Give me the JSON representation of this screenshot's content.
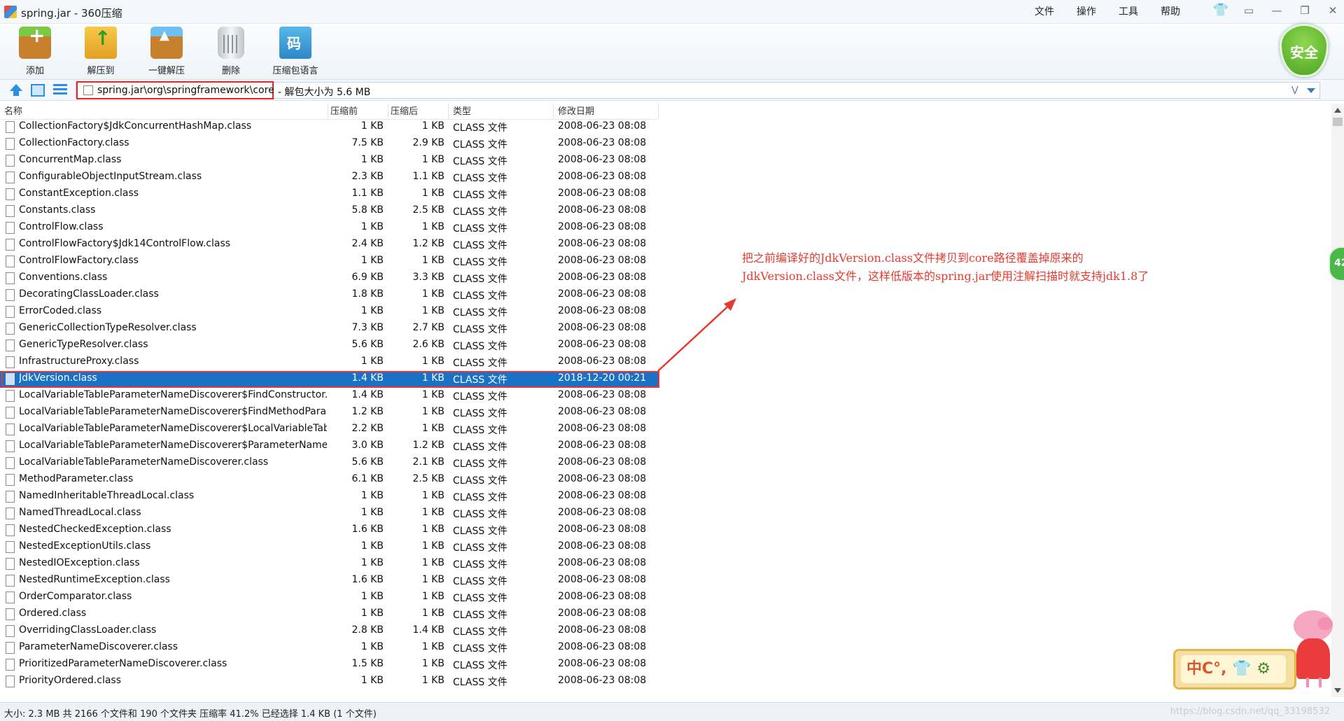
{
  "window": {
    "title": "spring.jar - 360压缩",
    "menu": [
      "文件",
      "操作",
      "工具",
      "帮助"
    ]
  },
  "toolbar": {
    "add_label": "添加",
    "extract_label": "解压到",
    "onekey_label": "一键解压",
    "delete_label": "删除",
    "lang_label": "压缩包语言",
    "security_label": "安全"
  },
  "address": {
    "path": "spring.jar\\org\\springframework\\core",
    "info": " - 解包大小为 5.6 MB",
    "v_icon": "V"
  },
  "columns": {
    "name": "名称",
    "size": "压缩前",
    "packed": "压缩后",
    "type": "类型",
    "date": "修改日期"
  },
  "files": [
    {
      "name": "CollectionFactory$JdkConcurrentHashMap.class",
      "size": "1 KB",
      "packed": "1 KB",
      "type": "CLASS 文件",
      "date": "2008-06-23 08:08"
    },
    {
      "name": "CollectionFactory.class",
      "size": "7.5 KB",
      "packed": "2.9 KB",
      "type": "CLASS 文件",
      "date": "2008-06-23 08:08"
    },
    {
      "name": "ConcurrentMap.class",
      "size": "1 KB",
      "packed": "1 KB",
      "type": "CLASS 文件",
      "date": "2008-06-23 08:08"
    },
    {
      "name": "ConfigurableObjectInputStream.class",
      "size": "2.3 KB",
      "packed": "1.1 KB",
      "type": "CLASS 文件",
      "date": "2008-06-23 08:08"
    },
    {
      "name": "ConstantException.class",
      "size": "1.1 KB",
      "packed": "1 KB",
      "type": "CLASS 文件",
      "date": "2008-06-23 08:08"
    },
    {
      "name": "Constants.class",
      "size": "5.8 KB",
      "packed": "2.5 KB",
      "type": "CLASS 文件",
      "date": "2008-06-23 08:08"
    },
    {
      "name": "ControlFlow.class",
      "size": "1 KB",
      "packed": "1 KB",
      "type": "CLASS 文件",
      "date": "2008-06-23 08:08"
    },
    {
      "name": "ControlFlowFactory$Jdk14ControlFlow.class",
      "size": "2.4 KB",
      "packed": "1.2 KB",
      "type": "CLASS 文件",
      "date": "2008-06-23 08:08"
    },
    {
      "name": "ControlFlowFactory.class",
      "size": "1 KB",
      "packed": "1 KB",
      "type": "CLASS 文件",
      "date": "2008-06-23 08:08"
    },
    {
      "name": "Conventions.class",
      "size": "6.9 KB",
      "packed": "3.3 KB",
      "type": "CLASS 文件",
      "date": "2008-06-23 08:08"
    },
    {
      "name": "DecoratingClassLoader.class",
      "size": "1.8 KB",
      "packed": "1 KB",
      "type": "CLASS 文件",
      "date": "2008-06-23 08:08"
    },
    {
      "name": "ErrorCoded.class",
      "size": "1 KB",
      "packed": "1 KB",
      "type": "CLASS 文件",
      "date": "2008-06-23 08:08"
    },
    {
      "name": "GenericCollectionTypeResolver.class",
      "size": "7.3 KB",
      "packed": "2.7 KB",
      "type": "CLASS 文件",
      "date": "2008-06-23 08:08"
    },
    {
      "name": "GenericTypeResolver.class",
      "size": "5.6 KB",
      "packed": "2.6 KB",
      "type": "CLASS 文件",
      "date": "2008-06-23 08:08"
    },
    {
      "name": "InfrastructureProxy.class",
      "size": "1 KB",
      "packed": "1 KB",
      "type": "CLASS 文件",
      "date": "2008-06-23 08:08"
    },
    {
      "name": "JdkVersion.class",
      "size": "1.4 KB",
      "packed": "1 KB",
      "type": "CLASS 文件",
      "date": "2018-12-20 00:21",
      "selected": true
    },
    {
      "name": "LocalVariableTableParameterNameDiscoverer$FindConstructor...",
      "size": "1.4 KB",
      "packed": "1 KB",
      "type": "CLASS 文件",
      "date": "2008-06-23 08:08"
    },
    {
      "name": "LocalVariableTableParameterNameDiscoverer$FindMethodPara...",
      "size": "1.2 KB",
      "packed": "1 KB",
      "type": "CLASS 文件",
      "date": "2008-06-23 08:08"
    },
    {
      "name": "LocalVariableTableParameterNameDiscoverer$LocalVariableTab...",
      "size": "2.2 KB",
      "packed": "1 KB",
      "type": "CLASS 文件",
      "date": "2008-06-23 08:08"
    },
    {
      "name": "LocalVariableTableParameterNameDiscoverer$ParameterName...",
      "size": "3.0 KB",
      "packed": "1.2 KB",
      "type": "CLASS 文件",
      "date": "2008-06-23 08:08"
    },
    {
      "name": "LocalVariableTableParameterNameDiscoverer.class",
      "size": "5.6 KB",
      "packed": "2.1 KB",
      "type": "CLASS 文件",
      "date": "2008-06-23 08:08"
    },
    {
      "name": "MethodParameter.class",
      "size": "6.1 KB",
      "packed": "2.5 KB",
      "type": "CLASS 文件",
      "date": "2008-06-23 08:08"
    },
    {
      "name": "NamedInheritableThreadLocal.class",
      "size": "1 KB",
      "packed": "1 KB",
      "type": "CLASS 文件",
      "date": "2008-06-23 08:08"
    },
    {
      "name": "NamedThreadLocal.class",
      "size": "1 KB",
      "packed": "1 KB",
      "type": "CLASS 文件",
      "date": "2008-06-23 08:08"
    },
    {
      "name": "NestedCheckedException.class",
      "size": "1.6 KB",
      "packed": "1 KB",
      "type": "CLASS 文件",
      "date": "2008-06-23 08:08"
    },
    {
      "name": "NestedExceptionUtils.class",
      "size": "1 KB",
      "packed": "1 KB",
      "type": "CLASS 文件",
      "date": "2008-06-23 08:08"
    },
    {
      "name": "NestedIOException.class",
      "size": "1 KB",
      "packed": "1 KB",
      "type": "CLASS 文件",
      "date": "2008-06-23 08:08"
    },
    {
      "name": "NestedRuntimeException.class",
      "size": "1.6 KB",
      "packed": "1 KB",
      "type": "CLASS 文件",
      "date": "2008-06-23 08:08"
    },
    {
      "name": "OrderComparator.class",
      "size": "1 KB",
      "packed": "1 KB",
      "type": "CLASS 文件",
      "date": "2008-06-23 08:08"
    },
    {
      "name": "Ordered.class",
      "size": "1 KB",
      "packed": "1 KB",
      "type": "CLASS 文件",
      "date": "2008-06-23 08:08"
    },
    {
      "name": "OverridingClassLoader.class",
      "size": "2.8 KB",
      "packed": "1.4 KB",
      "type": "CLASS 文件",
      "date": "2008-06-23 08:08"
    },
    {
      "name": "ParameterNameDiscoverer.class",
      "size": "1 KB",
      "packed": "1 KB",
      "type": "CLASS 文件",
      "date": "2008-06-23 08:08"
    },
    {
      "name": "PrioritizedParameterNameDiscoverer.class",
      "size": "1.5 KB",
      "packed": "1 KB",
      "type": "CLASS 文件",
      "date": "2008-06-23 08:08"
    },
    {
      "name": "PriorityOrdered.class",
      "size": "1 KB",
      "packed": "1 KB",
      "type": "CLASS 文件",
      "date": "2008-06-23 08:08"
    }
  ],
  "status": {
    "text": "大小: 2.3 MB 共 2166 个文件和 190 个文件夹 压缩率 41.2% 已经选择 1.4 KB (1 个文件)",
    "watermark": "https://blog.csdn.net/qq_33198532"
  },
  "annotation": {
    "line1": "把之前编译好的JdkVersion.class文件拷贝到core路径覆盖掉原来的",
    "line2": "JdkVersion.class文件，这样低版本的spring.jar使用注解扫描时就支持jdk1.8了"
  },
  "overlays": {
    "side_badge": "42",
    "ime_text": "中C°,"
  },
  "colors": {
    "selection": "#1a72c6",
    "annotation": "#e63a2e",
    "highlight_box": "#e22"
  }
}
